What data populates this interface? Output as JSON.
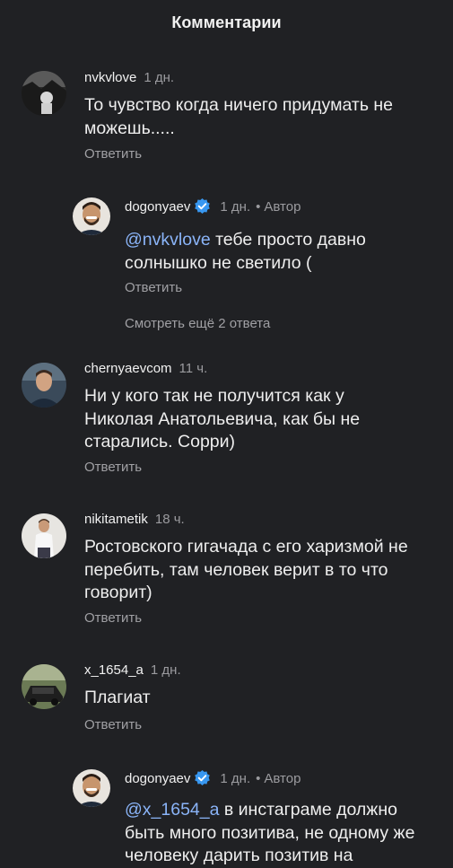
{
  "header": {
    "title": "Комментарии"
  },
  "reply_label": "Ответить",
  "author_label": "Автор",
  "comments": [
    {
      "username": "nvkvlove",
      "time": "1 дн.",
      "text": "То чувство когда ничего придумать не можешь.....",
      "avatar_icon": "user-avatar-dark"
    },
    {
      "username": "dogonyaev",
      "verified": true,
      "time": "1 дн.",
      "is_author": true,
      "mention": "@nvkvlove",
      "text": "тебе просто давно солнышко не светило (",
      "avatar_icon": "user-avatar-smiling-man"
    },
    {
      "username": "chernyaevcom",
      "time": "11 ч.",
      "text": "Ни у кого так не получится как у Николая Анатольевича, как бы не старались. Сорри)",
      "avatar_icon": "user-avatar-man-portrait"
    },
    {
      "username": "nikitametik",
      "time": "18 ч.",
      "text": "Ростовского гигачада с его харизмой не перебить, там человек верит в то что говорит)",
      "avatar_icon": "user-avatar-man-standing"
    },
    {
      "username": "x_1654_a",
      "time": "1 дн.",
      "text": "Плагиат",
      "avatar_icon": "user-avatar-car"
    },
    {
      "username": "dogonyaev",
      "verified": true,
      "time": "1 дн.",
      "is_author": true,
      "mention": "@x_1654_a",
      "text": "в инстаграме должно быть много позитива, не одному же человеку дарить позитив на",
      "avatar_icon": "user-avatar-smiling-man"
    }
  ],
  "more_replies_label": "Смотреть ещё 2 ответа",
  "colors": {
    "background": "#202124",
    "mention": "#8ab4f8",
    "verified": "#3897f0",
    "secondary_text": "#9b9b9f"
  }
}
